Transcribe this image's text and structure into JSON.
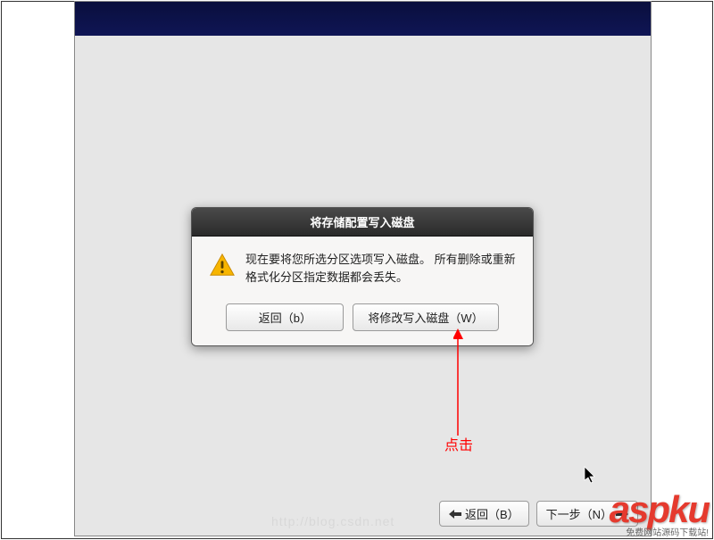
{
  "dialog": {
    "title": "将存储配置写入磁盘",
    "text": "现在要将您所选分区选项写入磁盘。 所有删除或重新格式化分区指定数据都会丢失。",
    "back_label": "返回（b）",
    "write_label": "将修改写入磁盘（W）"
  },
  "footer": {
    "back_label": "返回（B）",
    "next_label": "下一步（N）"
  },
  "annotation": {
    "click_text": "点击"
  },
  "watermark": {
    "url": "http://blog.csdn.net",
    "brand": "aspku",
    "subtext": "免费网站源码下载站!"
  }
}
